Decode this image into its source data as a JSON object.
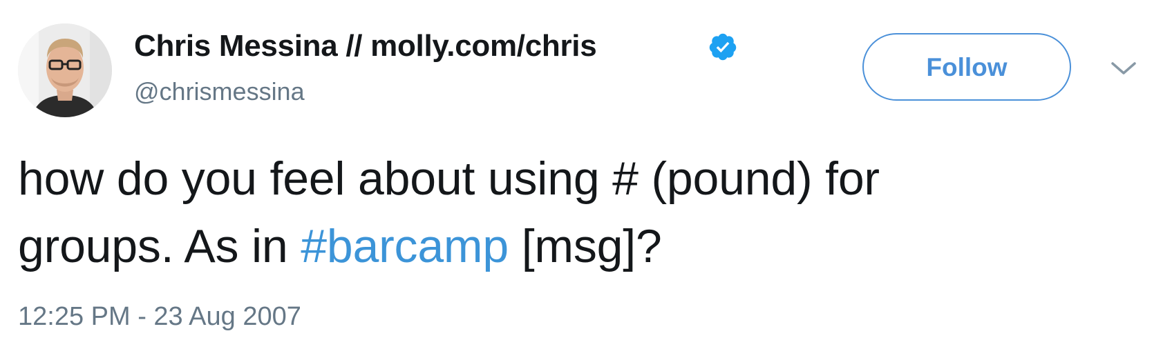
{
  "author": {
    "display_name": "Chris Messina // molly.com/chris",
    "handle": "@chrismessina",
    "verified": true
  },
  "actions": {
    "follow_label": "Follow"
  },
  "tweet": {
    "line1": "how do you feel about using # (pound) for",
    "line2_prefix": "groups. As in ",
    "hashtag": "#barcamp",
    "line2_suffix": " [msg]?",
    "timestamp": "12:25 PM - 23 Aug 2007"
  },
  "colors": {
    "link": "#3c94d8",
    "follow_border": "#4a90d9",
    "secondary_text": "#657786",
    "primary_text": "#14171a",
    "verified_badge": "#1da1f2"
  },
  "icons": {
    "verified": "verified-badge-icon",
    "menu": "chevron-down-icon"
  }
}
